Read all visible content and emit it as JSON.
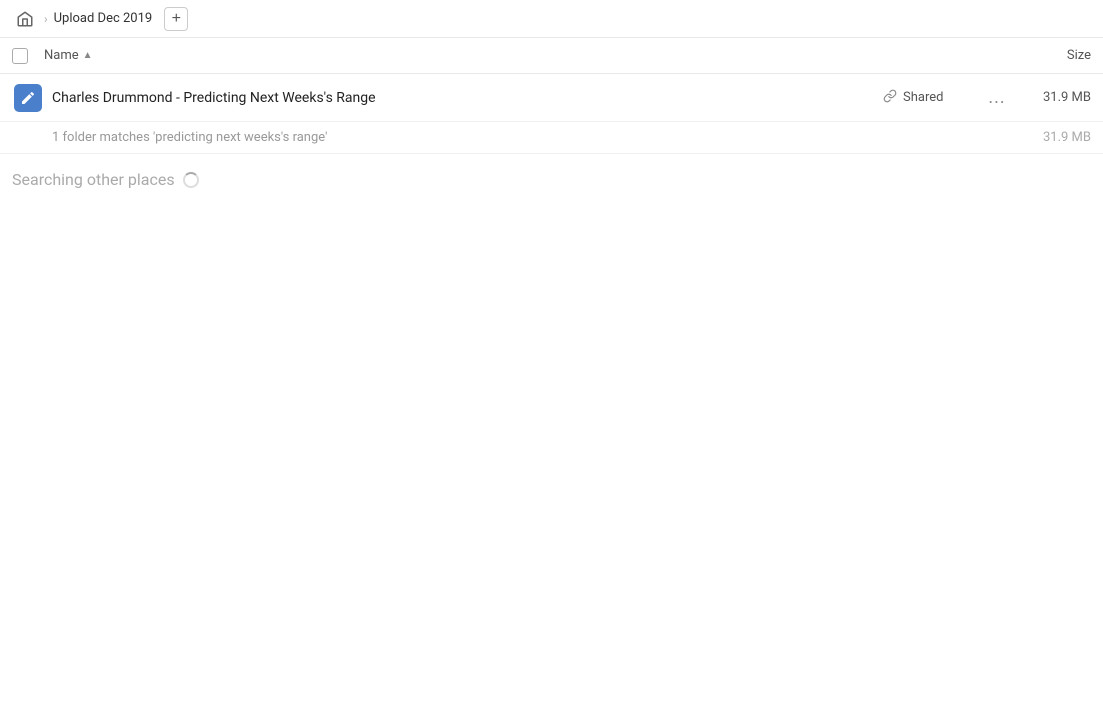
{
  "breadcrumb": {
    "home_icon": "home",
    "separator": "›",
    "title": "Upload Dec 2019",
    "add_button_label": "+"
  },
  "column_headers": {
    "name_label": "Name",
    "sort_arrow": "▲",
    "size_label": "Size"
  },
  "file_row": {
    "name": "Charles Drummond - Predicting Next Weeks's Range",
    "shared_label": "Shared",
    "size": "31.9 MB",
    "more_options": "..."
  },
  "matches_row": {
    "text": "1 folder matches 'predicting next weeks's range'",
    "size": "31.9 MB"
  },
  "searching_row": {
    "text": "Searching other places"
  }
}
